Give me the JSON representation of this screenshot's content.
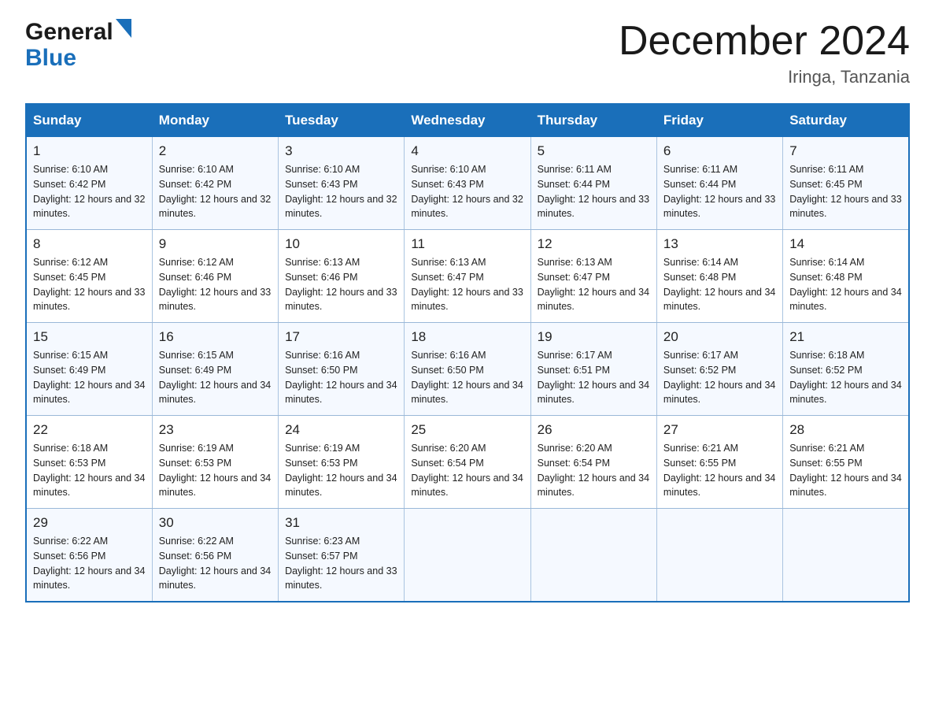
{
  "header": {
    "logo_line1": "General",
    "logo_line2": "Blue",
    "month_title": "December 2024",
    "location": "Iringa, Tanzania"
  },
  "calendar": {
    "days_of_week": [
      "Sunday",
      "Monday",
      "Tuesday",
      "Wednesday",
      "Thursday",
      "Friday",
      "Saturday"
    ],
    "weeks": [
      [
        {
          "day": "1",
          "sunrise": "6:10 AM",
          "sunset": "6:42 PM",
          "daylight": "12 hours and 32 minutes."
        },
        {
          "day": "2",
          "sunrise": "6:10 AM",
          "sunset": "6:42 PM",
          "daylight": "12 hours and 32 minutes."
        },
        {
          "day": "3",
          "sunrise": "6:10 AM",
          "sunset": "6:43 PM",
          "daylight": "12 hours and 32 minutes."
        },
        {
          "day": "4",
          "sunrise": "6:10 AM",
          "sunset": "6:43 PM",
          "daylight": "12 hours and 32 minutes."
        },
        {
          "day": "5",
          "sunrise": "6:11 AM",
          "sunset": "6:44 PM",
          "daylight": "12 hours and 33 minutes."
        },
        {
          "day": "6",
          "sunrise": "6:11 AM",
          "sunset": "6:44 PM",
          "daylight": "12 hours and 33 minutes."
        },
        {
          "day": "7",
          "sunrise": "6:11 AM",
          "sunset": "6:45 PM",
          "daylight": "12 hours and 33 minutes."
        }
      ],
      [
        {
          "day": "8",
          "sunrise": "6:12 AM",
          "sunset": "6:45 PM",
          "daylight": "12 hours and 33 minutes."
        },
        {
          "day": "9",
          "sunrise": "6:12 AM",
          "sunset": "6:46 PM",
          "daylight": "12 hours and 33 minutes."
        },
        {
          "day": "10",
          "sunrise": "6:13 AM",
          "sunset": "6:46 PM",
          "daylight": "12 hours and 33 minutes."
        },
        {
          "day": "11",
          "sunrise": "6:13 AM",
          "sunset": "6:47 PM",
          "daylight": "12 hours and 33 minutes."
        },
        {
          "day": "12",
          "sunrise": "6:13 AM",
          "sunset": "6:47 PM",
          "daylight": "12 hours and 34 minutes."
        },
        {
          "day": "13",
          "sunrise": "6:14 AM",
          "sunset": "6:48 PM",
          "daylight": "12 hours and 34 minutes."
        },
        {
          "day": "14",
          "sunrise": "6:14 AM",
          "sunset": "6:48 PM",
          "daylight": "12 hours and 34 minutes."
        }
      ],
      [
        {
          "day": "15",
          "sunrise": "6:15 AM",
          "sunset": "6:49 PM",
          "daylight": "12 hours and 34 minutes."
        },
        {
          "day": "16",
          "sunrise": "6:15 AM",
          "sunset": "6:49 PM",
          "daylight": "12 hours and 34 minutes."
        },
        {
          "day": "17",
          "sunrise": "6:16 AM",
          "sunset": "6:50 PM",
          "daylight": "12 hours and 34 minutes."
        },
        {
          "day": "18",
          "sunrise": "6:16 AM",
          "sunset": "6:50 PM",
          "daylight": "12 hours and 34 minutes."
        },
        {
          "day": "19",
          "sunrise": "6:17 AM",
          "sunset": "6:51 PM",
          "daylight": "12 hours and 34 minutes."
        },
        {
          "day": "20",
          "sunrise": "6:17 AM",
          "sunset": "6:52 PM",
          "daylight": "12 hours and 34 minutes."
        },
        {
          "day": "21",
          "sunrise": "6:18 AM",
          "sunset": "6:52 PM",
          "daylight": "12 hours and 34 minutes."
        }
      ],
      [
        {
          "day": "22",
          "sunrise": "6:18 AM",
          "sunset": "6:53 PM",
          "daylight": "12 hours and 34 minutes."
        },
        {
          "day": "23",
          "sunrise": "6:19 AM",
          "sunset": "6:53 PM",
          "daylight": "12 hours and 34 minutes."
        },
        {
          "day": "24",
          "sunrise": "6:19 AM",
          "sunset": "6:53 PM",
          "daylight": "12 hours and 34 minutes."
        },
        {
          "day": "25",
          "sunrise": "6:20 AM",
          "sunset": "6:54 PM",
          "daylight": "12 hours and 34 minutes."
        },
        {
          "day": "26",
          "sunrise": "6:20 AM",
          "sunset": "6:54 PM",
          "daylight": "12 hours and 34 minutes."
        },
        {
          "day": "27",
          "sunrise": "6:21 AM",
          "sunset": "6:55 PM",
          "daylight": "12 hours and 34 minutes."
        },
        {
          "day": "28",
          "sunrise": "6:21 AM",
          "sunset": "6:55 PM",
          "daylight": "12 hours and 34 minutes."
        }
      ],
      [
        {
          "day": "29",
          "sunrise": "6:22 AM",
          "sunset": "6:56 PM",
          "daylight": "12 hours and 34 minutes."
        },
        {
          "day": "30",
          "sunrise": "6:22 AM",
          "sunset": "6:56 PM",
          "daylight": "12 hours and 34 minutes."
        },
        {
          "day": "31",
          "sunrise": "6:23 AM",
          "sunset": "6:57 PM",
          "daylight": "12 hours and 33 minutes."
        },
        null,
        null,
        null,
        null
      ]
    ]
  }
}
